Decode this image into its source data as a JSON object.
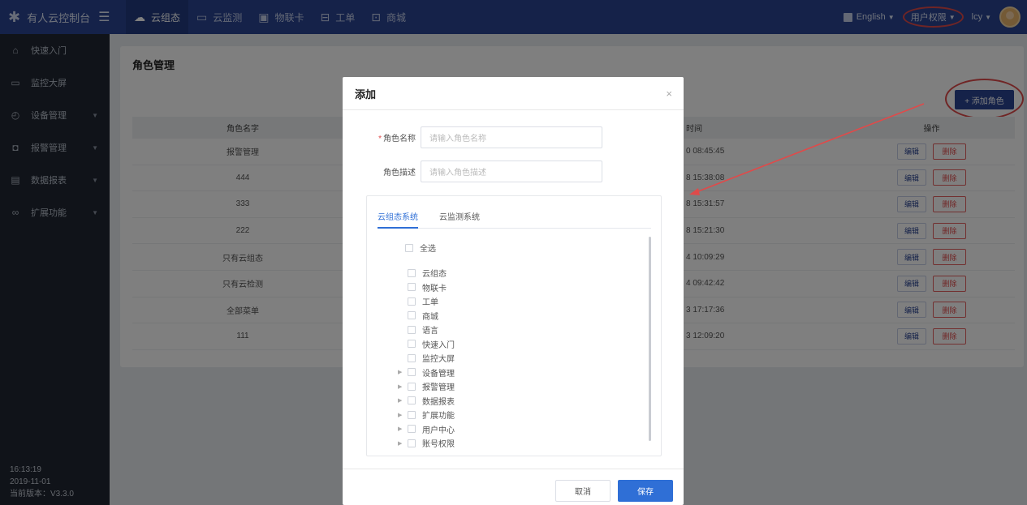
{
  "topbar": {
    "brand": "有人云控制台",
    "nav": [
      {
        "label": "云组态",
        "icon": "cloud-icon",
        "glyph": "☁",
        "active": true
      },
      {
        "label": "云监测",
        "icon": "monitor-icon",
        "glyph": "▭",
        "active": false
      },
      {
        "label": "物联卡",
        "icon": "sim-card-icon",
        "glyph": "▣",
        "active": false
      },
      {
        "label": "工单",
        "icon": "ticket-icon",
        "glyph": "⊟",
        "active": false
      },
      {
        "label": "商城",
        "icon": "shop-icon",
        "glyph": "⊡",
        "active": false
      }
    ],
    "language": "English",
    "user_perm": "用户权限",
    "user": "lcy"
  },
  "sidebar": {
    "items": [
      {
        "label": "快速入门",
        "icon": "home-icon",
        "glyph": "⌂",
        "expandable": false
      },
      {
        "label": "监控大屏",
        "icon": "screen-icon",
        "glyph": "▭",
        "expandable": false
      },
      {
        "label": "设备管理",
        "icon": "device-icon",
        "glyph": "◴",
        "expandable": true
      },
      {
        "label": "报警管理",
        "icon": "alarm-icon",
        "glyph": "◘",
        "expandable": true
      },
      {
        "label": "数据报表",
        "icon": "report-icon",
        "glyph": "▤",
        "expandable": true
      },
      {
        "label": "扩展功能",
        "icon": "extension-icon",
        "glyph": "∞",
        "expandable": true
      }
    ],
    "time": "16:13:19",
    "date": "2019-11-01",
    "version": "当前版本：V3.3.0"
  },
  "page": {
    "title": "角色管理",
    "add_button": "+ 添加角色",
    "columns": {
      "name": "角色名字",
      "time": "时间",
      "ops": "操作"
    },
    "edit_label": "编辑",
    "delete_label": "删除",
    "rows": [
      {
        "name": "报警管理",
        "time": "0 08:45:45"
      },
      {
        "name": "444",
        "time": "8 15:38:08"
      },
      {
        "name": "333",
        "time": "8 15:31:57"
      },
      {
        "name": "222",
        "time": "8 15:21:30"
      },
      {
        "name": "只有云组态",
        "time": "4 10:09:29"
      },
      {
        "name": "只有云检测",
        "time": "4 09:42:42"
      },
      {
        "name": "全部菜单",
        "time": "3 17:17:36"
      },
      {
        "name": "111",
        "time": "3 12:09:20"
      }
    ]
  },
  "modal": {
    "title": "添加",
    "close": "×",
    "name_label": "角色名称",
    "name_placeholder": "请输入角色名称",
    "desc_label": "角色描述",
    "desc_placeholder": "请输入角色描述",
    "tabs": [
      "云组态系统",
      "云监测系统"
    ],
    "select_all": "全选",
    "tree": [
      {
        "label": "云组态",
        "expandable": false
      },
      {
        "label": "物联卡",
        "expandable": false
      },
      {
        "label": "工单",
        "expandable": false
      },
      {
        "label": "商城",
        "expandable": false
      },
      {
        "label": "语言",
        "expandable": false
      },
      {
        "label": "快速入门",
        "expandable": false
      },
      {
        "label": "监控大屏",
        "expandable": false
      },
      {
        "label": "设备管理",
        "expandable": true
      },
      {
        "label": "报警管理",
        "expandable": true
      },
      {
        "label": "数据报表",
        "expandable": true
      },
      {
        "label": "扩展功能",
        "expandable": true
      },
      {
        "label": "用户中心",
        "expandable": true
      },
      {
        "label": "账号权限",
        "expandable": true
      }
    ],
    "cancel": "取消",
    "save": "保存"
  },
  "colors": {
    "topbar": "#2a4493",
    "sidebar": "#212733",
    "primary": "#2f6fd6",
    "annotation": "#e04a4a"
  }
}
